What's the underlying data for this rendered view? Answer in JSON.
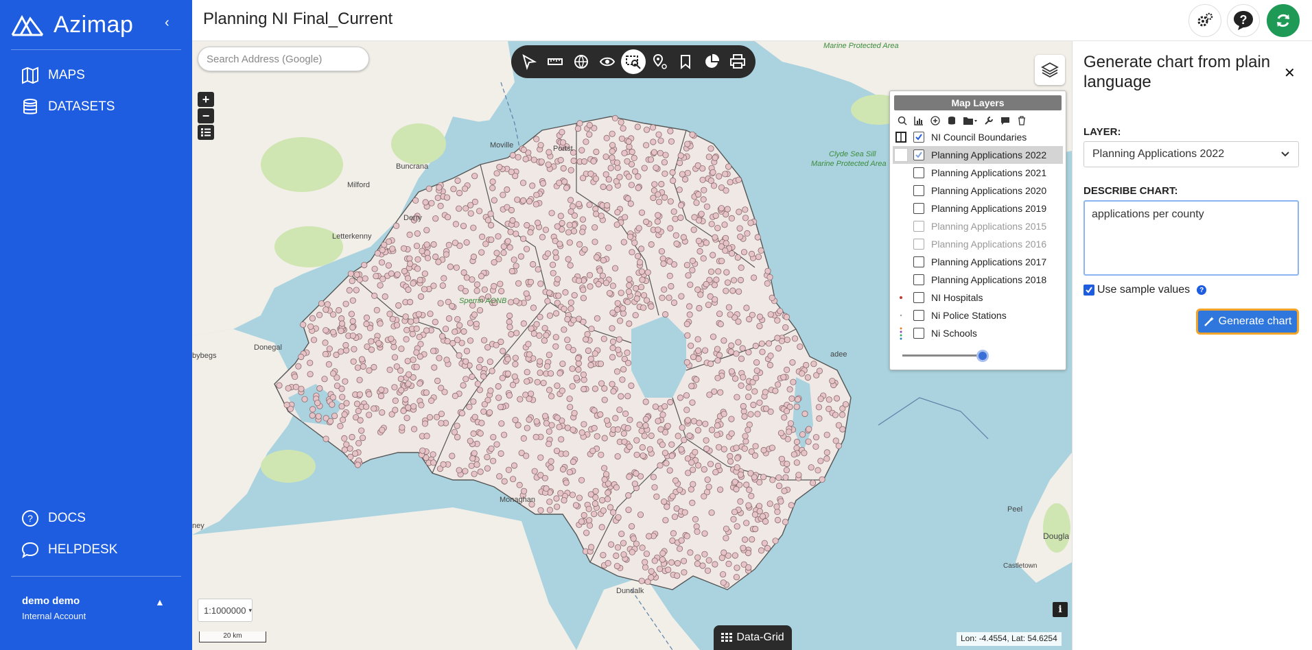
{
  "app": {
    "brand": "Azimap"
  },
  "sidebar": {
    "nav": [
      {
        "label": "MAPS",
        "icon": "book-map-icon"
      },
      {
        "label": "DATASETS",
        "icon": "database-icon"
      }
    ],
    "bottom_nav": [
      {
        "label": "DOCS",
        "icon": "question-circle-icon"
      },
      {
        "label": "HELPDESK",
        "icon": "chat-bubble-icon"
      }
    ],
    "user": {
      "name": "demo demo",
      "account": "Internal Account"
    }
  },
  "header": {
    "title": "Planning NI Final_Current"
  },
  "map": {
    "search_placeholder": "Search Address (Google)",
    "scale": "1:1000000",
    "scale_bar": "20 km",
    "coords": "Lon: -4.4554, Lat: 54.6254",
    "data_grid_label": "Data-Grid",
    "place_labels": [
      "Marine Protected Area",
      "Clyde Sea Sill",
      "Marine Protected Area",
      "Moville",
      "Portst",
      "Buncrana",
      "Milford",
      "Derry",
      "Letterkenny",
      "Sperrin AONB",
      "Donegal",
      "bybegs",
      "Monaghan",
      "ney",
      "Dundalk",
      "Peel",
      "Dougla",
      "Castletown",
      "adee"
    ]
  },
  "layers_panel": {
    "title": "Map Layers",
    "layers": [
      {
        "name": "NI Council Boundaries",
        "checked": true,
        "selected": false,
        "disabled": false
      },
      {
        "name": "Planning Applications 2022",
        "checked": true,
        "selected": true,
        "disabled": false
      },
      {
        "name": "Planning Applications 2021",
        "checked": false,
        "selected": false,
        "disabled": false
      },
      {
        "name": "Planning Applications 2020",
        "checked": false,
        "selected": false,
        "disabled": false
      },
      {
        "name": "Planning Applications 2019",
        "checked": false,
        "selected": false,
        "disabled": false
      },
      {
        "name": "Planning Applications 2015",
        "checked": false,
        "selected": false,
        "disabled": true
      },
      {
        "name": "Planning Applications 2016",
        "checked": false,
        "selected": false,
        "disabled": true
      },
      {
        "name": "Planning Applications 2017",
        "checked": false,
        "selected": false,
        "disabled": false
      },
      {
        "name": "Planning Applications 2018",
        "checked": false,
        "selected": false,
        "disabled": false
      },
      {
        "name": "NI Hospitals",
        "checked": false,
        "selected": false,
        "disabled": false
      },
      {
        "name": "Ni Police Stations",
        "checked": false,
        "selected": false,
        "disabled": false
      },
      {
        "name": "Ni Schools",
        "checked": false,
        "selected": false,
        "disabled": false
      }
    ],
    "opacity": 1.0
  },
  "chart_panel": {
    "title": "Generate chart from plain language",
    "layer_label": "LAYER:",
    "layer_value": "Planning Applications 2022",
    "describe_label": "DESCRIBE CHART:",
    "describe_value": "applications per county",
    "use_sample_label": "Use sample values",
    "use_sample_checked": true,
    "generate_label": "Generate chart"
  },
  "colors": {
    "brand_blue": "#1f5de0",
    "refresh_green": "#1e9a56",
    "sea": "#aad3df",
    "land": "#f2efe9",
    "point_fill": "#e6c3c6",
    "button_outline": "#f2a428"
  }
}
